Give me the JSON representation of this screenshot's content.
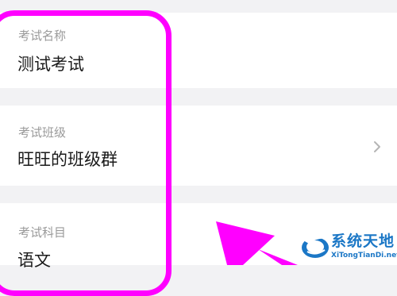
{
  "form": {
    "exam_name": {
      "label": "考试名称",
      "value": "测试考试"
    },
    "exam_class": {
      "label": "考试班级",
      "value": "旺旺的班级群",
      "chevron_icon": "chevron-right-icon"
    },
    "exam_subject": {
      "label": "考试科目",
      "value": "语文"
    }
  },
  "annotation": {
    "highlight_color": "#ff00ff"
  },
  "watermark": {
    "title": "系统天地",
    "url": "XiTongTianDi.net",
    "color": "#1b77c6"
  },
  "colors": {
    "page_background": "#f2f2f4",
    "card_background": "#ffffff",
    "label_text": "#9a9a9a",
    "value_text": "#1a1a1a",
    "chevron": "#b5b5b5"
  }
}
